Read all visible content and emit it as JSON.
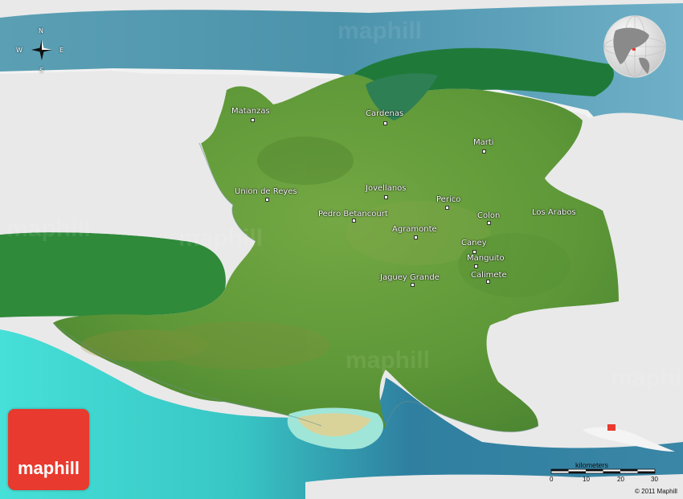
{
  "brand": {
    "name": "maphill",
    "watermark": "maphill",
    "color": "#e83a2e"
  },
  "compass": {
    "n": "N",
    "s": "S",
    "e": "E",
    "w": "W"
  },
  "cities": [
    {
      "name": "Matanzas"
    },
    {
      "name": "Cardenas"
    },
    {
      "name": "Marti"
    },
    {
      "name": "Union de Reyes"
    },
    {
      "name": "Jovellanos"
    },
    {
      "name": "Perico"
    },
    {
      "name": "Pedro Betancourt"
    },
    {
      "name": "Colon"
    },
    {
      "name": "Los Arabos"
    },
    {
      "name": "Agramonte"
    },
    {
      "name": "Caney"
    },
    {
      "name": "Manguito"
    },
    {
      "name": "Jaguey Grande"
    },
    {
      "name": "Calimete"
    }
  ],
  "scale": {
    "title": "kilometers",
    "ticks": [
      "0",
      "10",
      "20",
      "30"
    ]
  },
  "copyright": "© 2011 Maphill",
  "colors": {
    "land": "#5f9a3a",
    "land_dark": "#3f7a2a",
    "sea_shallow": "#3fd6d2",
    "sea_deep": "#3a7f99",
    "outside": "#e9e9e9"
  }
}
